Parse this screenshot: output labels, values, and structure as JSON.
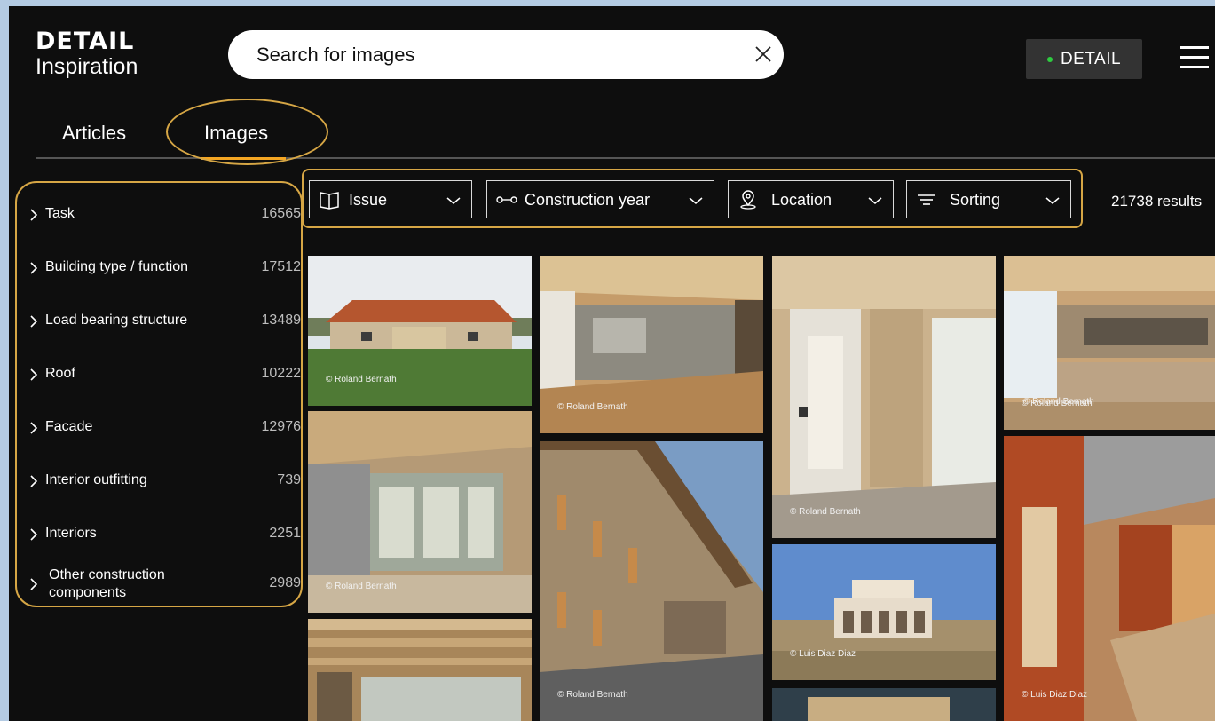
{
  "logo": {
    "top": "DETAIL",
    "bottom": "Inspiration"
  },
  "search": {
    "placeholder": "Search for images"
  },
  "header": {
    "detail_button": "DETAIL"
  },
  "tabs": [
    {
      "label": "Articles"
    },
    {
      "label": "Images"
    }
  ],
  "sidebar": {
    "items": [
      {
        "label": "Task",
        "count": "16565"
      },
      {
        "label": "Building type / function",
        "count": "17512"
      },
      {
        "label": "Load bearing structure",
        "count": "13489"
      },
      {
        "label": "Roof",
        "count": "10222"
      },
      {
        "label": "Facade",
        "count": "12976"
      },
      {
        "label": "Interior outfitting",
        "count": "739"
      },
      {
        "label": "Interiors",
        "count": "2251"
      },
      {
        "label": "Other construction components",
        "count": "2989"
      }
    ]
  },
  "filters": [
    {
      "label": "Issue",
      "icon": "book-icon"
    },
    {
      "label": "Construction year",
      "icon": "range-slider-icon"
    },
    {
      "label": "Location",
      "icon": "location-pin-icon"
    },
    {
      "label": "Sorting",
      "icon": "sort-lines-icon"
    }
  ],
  "results": {
    "text": "21738 results"
  },
  "images": [
    {
      "credit": "© Roland Bernath"
    },
    {
      "credit": "© Roland Bernath"
    },
    {
      "credit": "© Roland Bernath"
    },
    {
      "credit": "© Roland Bernath"
    },
    {
      "credit": "© Roland Bernath"
    },
    {
      "credit": "© Roland Bernath"
    },
    {
      "credit": "© Roland Bernath"
    },
    {
      "credit": "© Luis Diaz Diaz"
    },
    {
      "credit": "© Luis Diaz Diaz"
    }
  ],
  "colors": {
    "accent": "#f5a623",
    "highlight": "#d6a645",
    "status_dot": "#2ecc40",
    "background": "#0e0e0e"
  }
}
